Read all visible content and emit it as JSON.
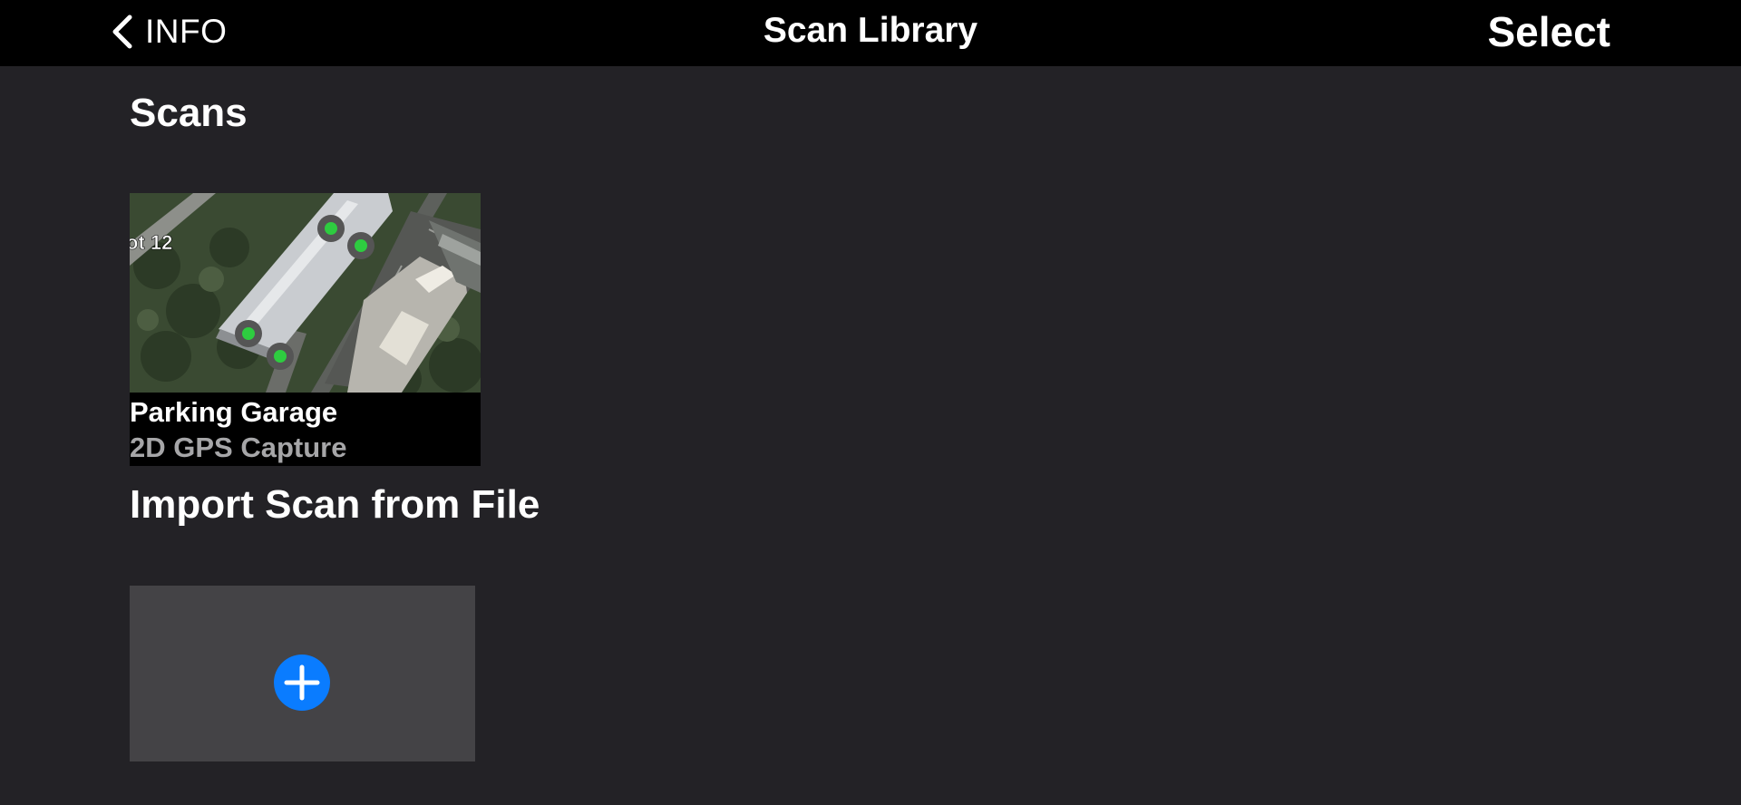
{
  "nav": {
    "back_label": "INFO",
    "title": "Scan Library",
    "select_label": "Select"
  },
  "scans_section": {
    "title": "Scans",
    "items": [
      {
        "name": "Parking Garage",
        "type": "2D GPS Capture",
        "map_label": "ot 12"
      }
    ]
  },
  "import_section": {
    "title": "Import Scan from File",
    "add_icon": "plus-circle-icon"
  },
  "colors": {
    "background": "#232226",
    "navbar": "#000000",
    "tile": "#444346",
    "accent": "#0a7cff",
    "marker": "#2ecc40",
    "secondary_text": "#a6a6a8"
  }
}
